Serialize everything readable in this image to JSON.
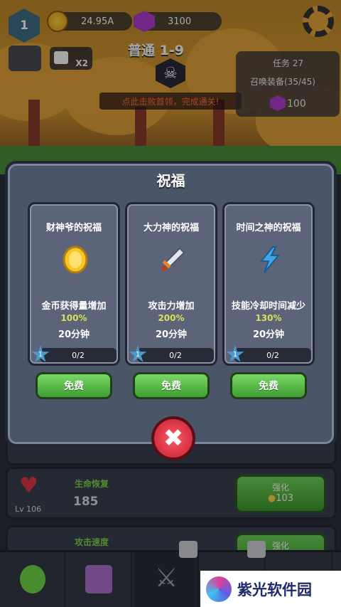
{
  "hud": {
    "player_level": "1",
    "gold": "24.95A",
    "gems": "3100",
    "speed_label": "X2",
    "stage": "普通 1-9",
    "boss_tip": "点此击败首领，完成通关!",
    "quest_title": "任务 27",
    "quest_desc": "召唤装备(35/45)",
    "quest_reward": "100"
  },
  "dialog": {
    "title": "祝福",
    "cards": [
      {
        "title": "财神爷的祝福",
        "icon": "gold-coin-icon",
        "desc": "金币获得量增加",
        "percent": "100%",
        "duration": "20分钟",
        "level": "1",
        "progress": "0/2",
        "button": "免费"
      },
      {
        "title": "大力神的祝福",
        "icon": "sword-icon",
        "desc": "攻击力增加",
        "percent": "200%",
        "duration": "20分钟",
        "level": "1",
        "progress": "0/2",
        "button": "免费"
      },
      {
        "title": "时间之神的祝福",
        "icon": "lightning-icon",
        "desc": "技能冷却时间减少",
        "percent": "130%",
        "duration": "20分钟",
        "level": "1",
        "progress": "0/2",
        "button": "免费"
      }
    ],
    "close_icon": "close-x-icon"
  },
  "list": {
    "rows": [
      {
        "name": "生命恢复",
        "level": "Lv 106",
        "value": "185",
        "button_label": "强化",
        "cost": "103"
      },
      {
        "name": "攻击速度",
        "button_label": "强化"
      }
    ]
  },
  "watermark": {
    "text": "紫光软件园"
  }
}
